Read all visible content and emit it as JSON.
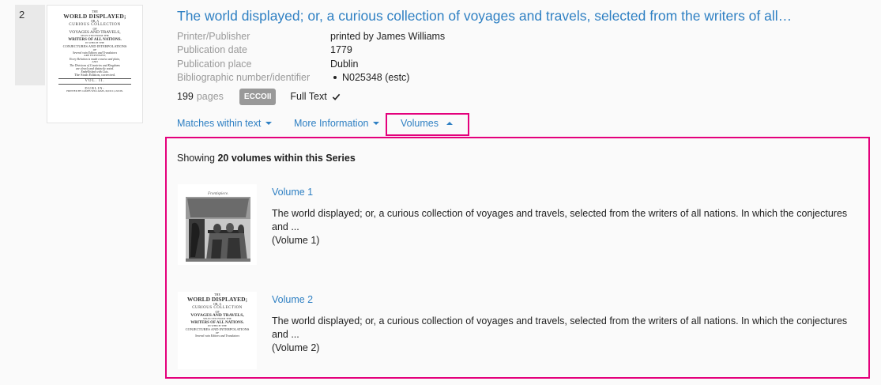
{
  "result": {
    "number": "2",
    "title": "The world displayed; or, a curious collection of voyages and travels, selected from the writers of all…",
    "thumbnail_text": {
      "line1": "THE",
      "line2": "WORLD DISPLAYED;",
      "line3": "OR, A",
      "line4": "CURIOUS COLLECTION",
      "line5": "OF",
      "line6": "VOYAGES AND TRAVELS,",
      "line7": "SELECTED FROM THE",
      "line8": "WRITERS OF ALL NATIONS.",
      "line9": "IN WHICH THE",
      "line10": "CONJECTURES AND INTERPOLATIONS",
      "line11": "OF",
      "line12": "Several vain Editors and Translators",
      "line13": "ARE EXPUNGED;",
      "line14": "Every Relation is made concise and plain,",
      "line15": "AND",
      "line16": "The Divisions of Countries and Kingdoms",
      "line17": "are clearly and distinctly noted.",
      "line18": "Embellished with Cuts.",
      "line19": "The Sixth Edition, corrected.",
      "line20": "VOL. II.",
      "line21": "DUBLIN:",
      "line22": "PRINTED BY JAMES WILLIAMS, M,DCC,LXXIX."
    },
    "meta": [
      {
        "label": "Printer/Publisher",
        "value": "printed by James Williams"
      },
      {
        "label": "Publication date",
        "value": "1779"
      },
      {
        "label": "Publication place",
        "value": "Dublin"
      },
      {
        "label": "Bibliographic number/identifier",
        "value": "N025348 (estc)"
      }
    ],
    "pages_count": "199",
    "pages_word": "pages",
    "badge": "ECCOII",
    "full_text": "Full Text",
    "tabs": {
      "matches": "Matches within text",
      "more_info": "More Information",
      "volumes": "Volumes"
    }
  },
  "volumes_panel": {
    "showing_prefix": "Showing",
    "showing_bold": "20 volumes within this Series",
    "volumes": [
      {
        "link": "Volume 1",
        "description": "The world displayed; or, a curious collection of voyages and travels, selected from the writers of all nations. In which the conjectures and ...",
        "subtitle": "(Volume 1)",
        "thumb_caption": "Frontispiece."
      },
      {
        "link": "Volume 2",
        "description": "The world displayed; or, a curious collection of voyages and travels, selected from the writers of all nations. In which the conjectures and ...",
        "subtitle": "(Volume 2)",
        "thumb_lines": [
          "THE",
          "WORLD DISPLAYED;",
          "OR, A",
          "CURIOUS COLLECTION",
          "OF",
          "VOYAGES AND TRAVELS,",
          "SELECTED FROM THE",
          "WRITERS OF ALL NATIONS.",
          "IN WHICH THE",
          "CONJECTURES AND INTERPOLATIONS",
          "OF",
          "Several vain Editors and Translators"
        ]
      }
    ]
  },
  "colors": {
    "link": "#2f80c3",
    "highlight": "#e4007c",
    "badge": "#999999"
  }
}
